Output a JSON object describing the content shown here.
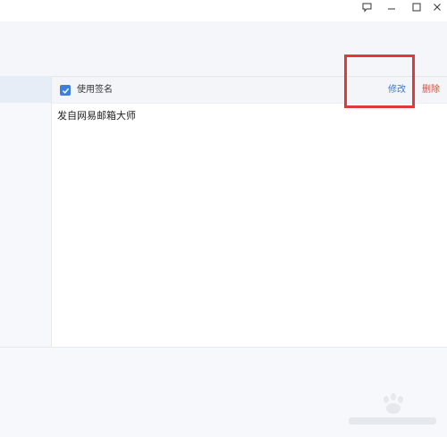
{
  "signature": {
    "use_signature_label": "使用签名",
    "use_signature_checked": true,
    "edit_label": "修改",
    "delete_label": "删除",
    "signature_text": "发自网易邮箱大师"
  },
  "window_controls": {
    "feedback_icon": "chat-bubble-icon",
    "minimize_icon": "minimize-icon",
    "maximize_icon": "maximize-icon",
    "close_icon": "close-icon"
  },
  "colors": {
    "accent": "#3f7fdc",
    "edit_link": "#3a78d6",
    "delete_link": "#e04b3b",
    "highlight": "#e0393c"
  }
}
